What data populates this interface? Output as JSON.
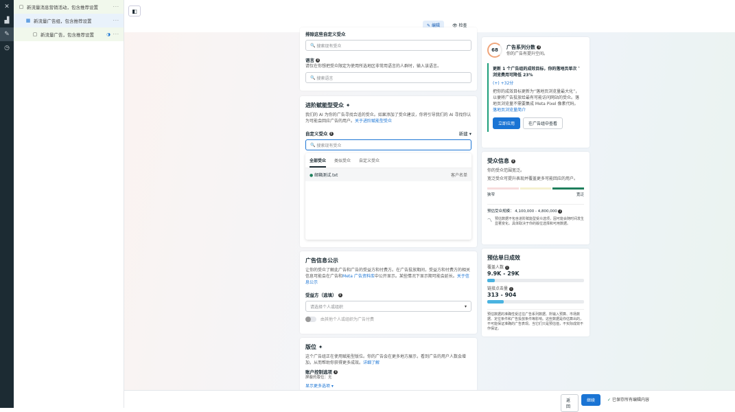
{
  "sidebar": {
    "campaign": "新流量消息营销活动，包含推荐设置",
    "adset": "新流量广告组，包含推荐设置",
    "ad": "新流量广告，包含推荐设置",
    "more": "···"
  },
  "modes": {
    "edit": "编辑",
    "review": "检查"
  },
  "exclude": {
    "title": "排除这些自定义受众",
    "search_placeholder": "搜索现有受众",
    "lang_title": "语言",
    "lang_desc": "请仅在你想把受众限定为使用所选地区非常用语言的人群时，输入该语言。",
    "lang_placeholder": "搜索语言"
  },
  "advantage": {
    "title": "进阶赋能型受众",
    "desc": "我们的 AI 为你的广告寻找合适的受众。如果添加了受众建议，你将引导我们的 AI 寻找你认为可能会回应广告的用户。",
    "link": "关于进阶赋能型受众",
    "custom_label": "自定义受众",
    "new": "新建",
    "search_placeholder": "搜索现有受众",
    "tabs": [
      "全部受众",
      "类似受众",
      "自定义受众"
    ],
    "item": "邮箱测试.txt",
    "item_type": "客户名单"
  },
  "disclosure": {
    "title": "广告信息公示",
    "desc": "让你的受众了解此广告和广告的受益方和付费方。在广告投放期间，受益方和付费方的相关信息可能会在广告和",
    "meta_link": "Meta 广告资料库",
    "desc2": "中公开显示。某些情况下显示期可能会延长。",
    "link": "关于信息公示",
    "beneficiary_label": "受益方（选填）",
    "beneficiary_placeholder": "请选择个人或组织",
    "toggle_label": "由其他个人或组织为广告付费"
  },
  "placement": {
    "title": "版位",
    "desc": "这个广告组正在使用赋能型版位。你的广告会在更多地方展示，看到广告的用户人数会增加，从而帮助你获得更多成效。",
    "link": "详细了解",
    "control_label": "账户控制选项",
    "excluded": "屏蔽的版位：无",
    "more": "显示更多选项 ▾"
  },
  "score": {
    "value": "68",
    "title": "广告系列分数",
    "sub": "你的广告有提升空间。",
    "rec_title": "更新 1 个广告组的成效目标，你的落地页单次浏览费用可降低 23%",
    "points": "(+) +32分",
    "rec_desc": "把你的成效目标更新为“落地页浏览量最大化”，以便将广告投放给最有可能访问网站的受众。落地页浏览量不需要集成 Meta Pixel 像素代码。",
    "rec_link": "落地页浏览量简介",
    "apply": "立即应用",
    "view": "在广告组中查看"
  },
  "audience": {
    "title": "受众信息",
    "sub": "你的受众范围宽泛。",
    "desc": "宽泛受众可提升表现并覆盖更多可能回应的用户。",
    "narrow": "狭窄",
    "broad": "宽泛",
    "size_label": "预估受众规模：",
    "size": "4,100,000 - 4,800,000",
    "note": "预估数据不包含进阶赋能型受众选项，因可能会随时间发生显著变化。具体取决于你的版位选择和可用数据。",
    "level": 0.85
  },
  "results": {
    "title": "预估单日成效",
    "reach_label": "覆盖人数",
    "reach": "9.9K - 29K",
    "reach_fill": 0.08,
    "clicks_label": "链接点击量",
    "clicks": "313 - 904",
    "clicks_fill": 0.17,
    "note": "预估数据的准确性受过往广告系列数据、所输入预算、市场数据、定位条件和广告投放条件等影响。这些数据是你估算出的，不可能保证准确的广告表现。当它们只是预估值，不实际成效不作保证。"
  },
  "footer": {
    "saved": "已保存所有编辑内容",
    "back": "返回",
    "next": "继续"
  }
}
